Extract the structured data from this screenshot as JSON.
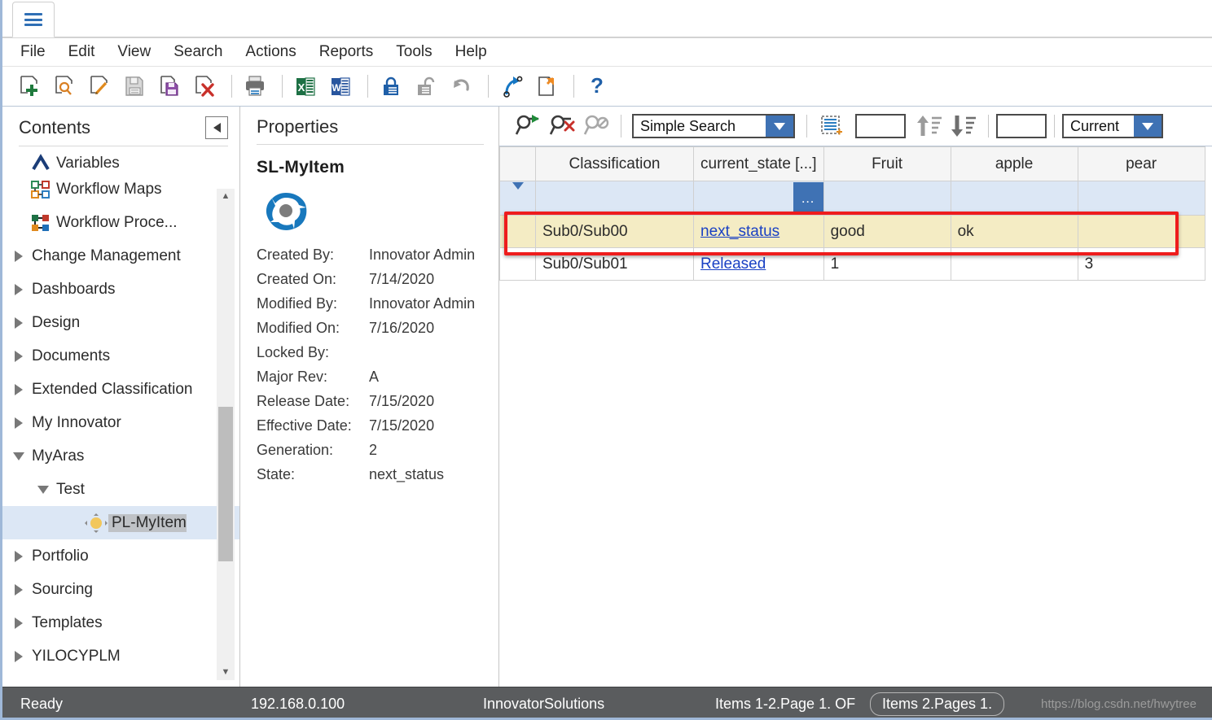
{
  "window": {
    "tab_icon": "hamburger-icon"
  },
  "menubar": {
    "items": [
      "File",
      "Edit",
      "View",
      "Search",
      "Actions",
      "Reports",
      "Tools",
      "Help"
    ]
  },
  "toolbar": {
    "buttons": [
      {
        "name": "new-item-icon",
        "title": "New"
      },
      {
        "name": "search-item-icon",
        "title": "Search"
      },
      {
        "name": "edit-item-icon",
        "title": "Edit"
      },
      {
        "name": "save-icon",
        "title": "Save"
      },
      {
        "name": "save-item-icon",
        "title": "Save Item"
      },
      {
        "name": "delete-item-icon",
        "title": "Delete"
      },
      {
        "name": "print-icon",
        "title": "Print"
      },
      {
        "name": "export-excel-icon",
        "title": "Export to Excel"
      },
      {
        "name": "export-word-icon",
        "title": "Export to Word"
      },
      {
        "name": "lock-icon",
        "title": "Lock"
      },
      {
        "name": "unlock-icon",
        "title": "Unlock"
      },
      {
        "name": "undo-icon",
        "title": "Undo"
      },
      {
        "name": "promote-icon",
        "title": "Promote"
      },
      {
        "name": "copy-item-icon",
        "title": "Copy"
      },
      {
        "name": "help-icon",
        "title": "Help"
      }
    ]
  },
  "contents": {
    "title": "Contents",
    "collapse_icon": "collapse-left-icon",
    "items": [
      {
        "label": "Variables",
        "icon": "variables-icon",
        "indent": 1,
        "expander": "none",
        "clipped": true,
        "selected": false
      },
      {
        "label": "Workflow Maps",
        "icon": "workflow-map-icon",
        "indent": 1,
        "expander": "none",
        "selected": false
      },
      {
        "label": "Workflow Proce...",
        "icon": "workflow-process-icon",
        "indent": 1,
        "expander": "none",
        "selected": false
      },
      {
        "label": "Change Management",
        "icon": "none",
        "indent": 0,
        "expander": "right",
        "selected": false
      },
      {
        "label": "Dashboards",
        "icon": "none",
        "indent": 0,
        "expander": "right",
        "selected": false
      },
      {
        "label": "Design",
        "icon": "none",
        "indent": 0,
        "expander": "right",
        "selected": false
      },
      {
        "label": "Documents",
        "icon": "none",
        "indent": 0,
        "expander": "right",
        "selected": false
      },
      {
        "label": "Extended Classification",
        "icon": "none",
        "indent": 0,
        "expander": "right",
        "selected": false
      },
      {
        "label": "My Innovator",
        "icon": "none",
        "indent": 0,
        "expander": "right",
        "selected": false
      },
      {
        "label": "MyAras",
        "icon": "none",
        "indent": 0,
        "expander": "down",
        "selected": false
      },
      {
        "label": "Test",
        "icon": "none",
        "indent": 1,
        "expander": "down",
        "selected": false
      },
      {
        "label": "PL-MyItem",
        "icon": "item-type-icon",
        "indent": 2,
        "expander": "none",
        "selected": true
      },
      {
        "label": "Portfolio",
        "icon": "none",
        "indent": 0,
        "expander": "right",
        "selected": false
      },
      {
        "label": "Sourcing",
        "icon": "none",
        "indent": 0,
        "expander": "right",
        "selected": false
      },
      {
        "label": "Templates",
        "icon": "none",
        "indent": 0,
        "expander": "right",
        "selected": false
      },
      {
        "label": "YILOCYPLM",
        "icon": "none",
        "indent": 0,
        "expander": "right",
        "selected": false
      }
    ]
  },
  "properties": {
    "title": "Properties",
    "item_name": "SL-MyItem",
    "logo_icon": "aras-innovator-logo",
    "rows": [
      {
        "label": "Created By:",
        "value": "Innovator Admin"
      },
      {
        "label": "Created On:",
        "value": "7/14/2020"
      },
      {
        "label": "Modified By:",
        "value": "Innovator Admin"
      },
      {
        "label": "Modified On:",
        "value": "7/16/2020"
      },
      {
        "label": "Locked By:",
        "value": ""
      },
      {
        "label": "Major Rev:",
        "value": "A"
      },
      {
        "label": "Release Date:",
        "value": "7/15/2020"
      },
      {
        "label": "Effective Date:",
        "value": "7/15/2020"
      },
      {
        "label": "Generation:",
        "value": "2"
      },
      {
        "label": "State:",
        "value": "next_status"
      }
    ]
  },
  "search": {
    "run_search_icon": "run-search-icon",
    "clear_search_icon": "clear-search-icon",
    "disable_search_icon": "disable-search-icon",
    "mode": "Simple Search",
    "select_all_icon": "select-all-rows-icon",
    "page_size_value": "",
    "sort_asc_icon": "sort-ascending-icon",
    "sort_desc_icon": "sort-descending-icon",
    "page_number_value": "",
    "revision_filter": "Current"
  },
  "grid": {
    "columns": [
      "",
      "Classification",
      "current_state [...]",
      "Fruit",
      "apple",
      "pear"
    ],
    "filter_row": {
      "expander_icon": "chevron-down-icon",
      "more_button": "…"
    },
    "rows": [
      {
        "highlighted": true,
        "cells": [
          "",
          "Sub0/Sub00",
          "next_status",
          "good",
          "ok",
          ""
        ],
        "link_col": 2
      },
      {
        "highlighted": false,
        "cells": [
          "",
          "Sub0/Sub01",
          "Released",
          "1",
          "",
          "3"
        ],
        "link_col": 2
      }
    ]
  },
  "statusbar": {
    "state": "Ready",
    "server": "192.168.0.100",
    "database": "InnovatorSolutions",
    "items_text": "Items 1-2.Page 1. OF",
    "pages_badge": "Items 2.Pages 1.",
    "watermark": "https://blog.csdn.net/hwytree"
  },
  "colors": {
    "accent": "#3f72b4",
    "highlight_border": "#ee1c1c",
    "row_highlight": "#f4ecc4",
    "filter_row": "#dce7f5",
    "status_bg": "#5a5c5e"
  }
}
